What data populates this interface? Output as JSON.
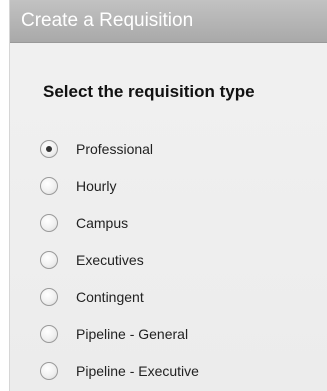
{
  "dialog": {
    "title": "Create a Requisition",
    "heading": "Select the requisition type"
  },
  "requisition_types": {
    "selected": "Professional",
    "options": [
      {
        "label": "Professional",
        "selected": true
      },
      {
        "label": "Hourly",
        "selected": false
      },
      {
        "label": "Campus",
        "selected": false
      },
      {
        "label": "Executives",
        "selected": false
      },
      {
        "label": "Contingent",
        "selected": false
      },
      {
        "label": "Pipeline - General",
        "selected": false
      },
      {
        "label": "Pipeline - Executive",
        "selected": false
      }
    ]
  },
  "colors": {
    "header_bg": "#b3b3b3",
    "header_text": "#ffffff",
    "panel_bg": "#efefef"
  }
}
